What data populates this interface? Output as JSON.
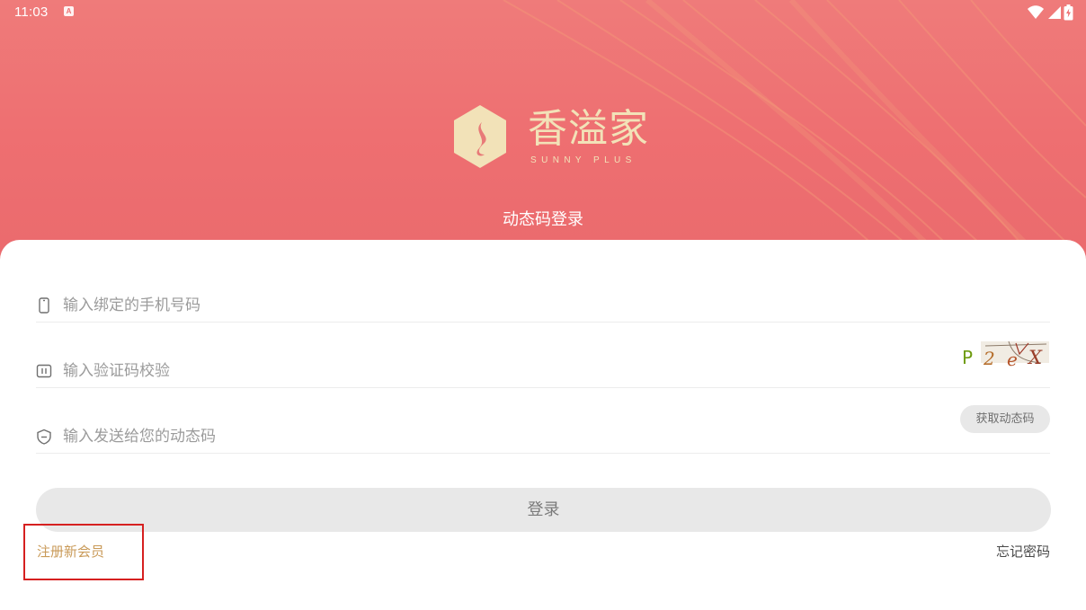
{
  "status_bar": {
    "time": "11:03",
    "notification_icon": "A",
    "icons": [
      "wifi-icon",
      "signal-icon",
      "battery-charging-icon"
    ]
  },
  "brand": {
    "name_cn": "香溢家",
    "name_en": "SUNNY PLUS",
    "logo_icon": "smoke-hexagon-icon",
    "gold_color": "#f2e2b8"
  },
  "hero": {
    "mode_title": "动态码登录",
    "background_color": "#ee6f71"
  },
  "form": {
    "phone": {
      "placeholder": "输入绑定的手机号码",
      "icon": "phone-icon"
    },
    "captcha": {
      "placeholder": "输入验证码校验",
      "icon": "captcha-icon",
      "image_text": "P2eX"
    },
    "dynamic_code": {
      "placeholder": "输入发送给您的动态码",
      "icon": "shield-icon",
      "button_label": "获取动态码"
    },
    "login_label": "登录",
    "register_label": "注册新会员",
    "forgot_label": "忘记密码",
    "register_color": "#c99a58"
  }
}
